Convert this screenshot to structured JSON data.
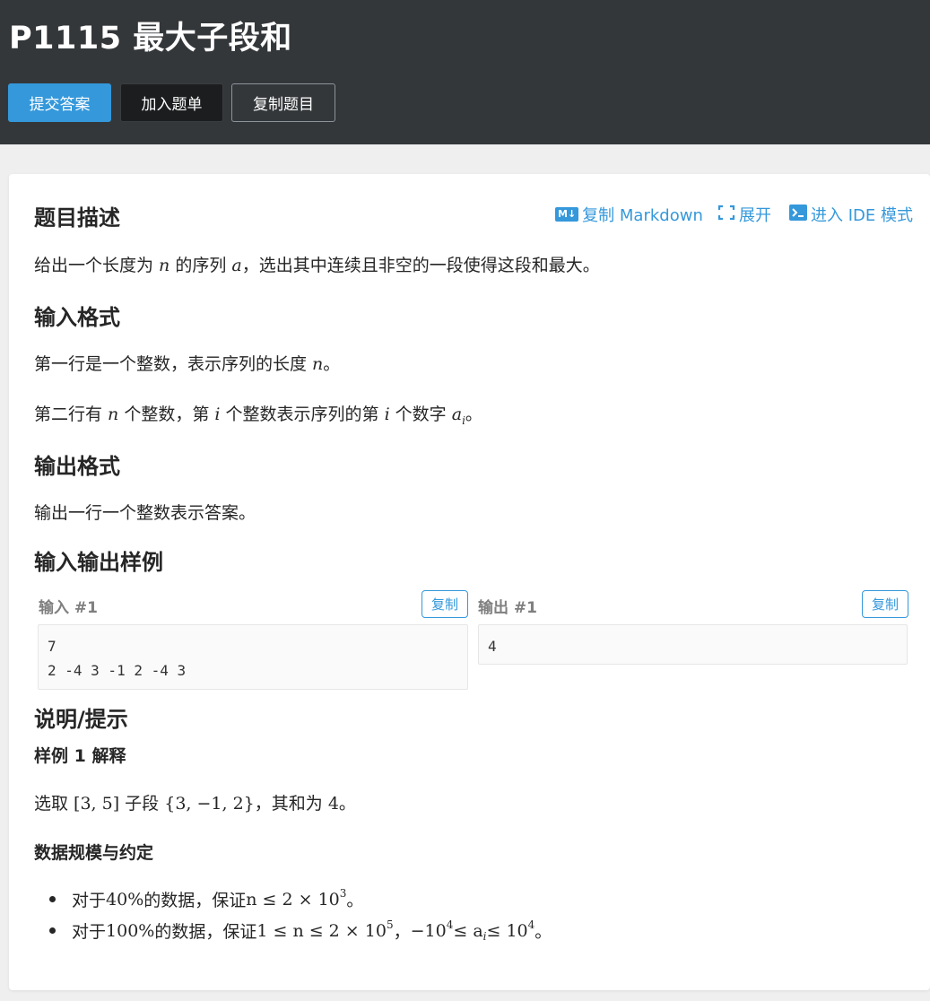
{
  "header": {
    "title": "P1115 最大子段和",
    "buttons": {
      "submit": "提交答案",
      "add_list": "加入题单",
      "copy_problem": "复制题目"
    }
  },
  "toolbar": {
    "markdown_icon": "M↓",
    "markdown": "复制 Markdown",
    "expand": "展开",
    "ide": "进入 IDE 模式"
  },
  "sections": {
    "description": {
      "heading": "题目描述",
      "text_a": "给出一个长度为 ",
      "var_n": "n",
      "text_b": " 的序列 ",
      "var_a": "a",
      "text_c": "，选出其中连续且非空的一段使得这段和最大。"
    },
    "input": {
      "heading": "输入格式",
      "line1_a": "第一行是一个整数，表示序列的长度 ",
      "line1_var": "n",
      "line1_b": "。",
      "line2_a": "第二行有 ",
      "line2_n": "n",
      "line2_b": " 个整数，第 ",
      "line2_i": "i",
      "line2_c": " 个整数表示序列的第 ",
      "line2_i2": "i",
      "line2_d": " 个数字 ",
      "line2_ai": "a",
      "line2_ai_sub": "i",
      "line2_e": "。"
    },
    "output": {
      "heading": "输出格式",
      "text": "输出一行一个整数表示答案。"
    },
    "samples": {
      "heading": "输入输出样例",
      "input_label": "输入 #1",
      "output_label": "输出 #1",
      "copy": "复制",
      "input_data": "7\n2 -4 3 -1 2 -4 3",
      "output_data": "4"
    },
    "hint": {
      "heading": "说明/提示",
      "sub1": "样例 1 解释",
      "explain_a": "选取 ",
      "explain_range": "[3, 5]",
      "explain_b": " 子段 ",
      "explain_set": "{3, −1, 2}",
      "explain_c": "，其和为 ",
      "explain_sum": "4",
      "explain_d": "。",
      "sub2": "数据规模与约定",
      "bullet1_a": "对于 ",
      "bullet1_pct": "40%",
      "bullet1_b": " 的数据，保证 ",
      "bullet1_math": "n ≤ 2 × 10",
      "bullet1_exp": "3",
      "bullet1_c": "。",
      "bullet2_a": "对于 ",
      "bullet2_pct": "100%",
      "bullet2_b": " 的数据，保证 ",
      "bullet2_math1": "1 ≤ n ≤ 2 × 10",
      "bullet2_exp1": "5",
      "bullet2_sep": "，",
      "bullet2_math2": "−10",
      "bullet2_exp2": "4",
      "bullet2_math3": " ≤ a",
      "bullet2_sub": "i",
      "bullet2_math4": " ≤ 10",
      "bullet2_exp3": "4",
      "bullet2_c": "。"
    }
  }
}
